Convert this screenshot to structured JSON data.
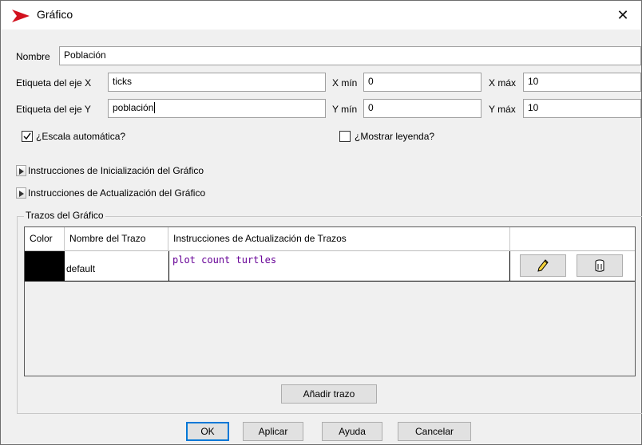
{
  "window": {
    "title": "Gráfico",
    "close_glyph": "✕",
    "accent_color": "#d2111e"
  },
  "form": {
    "name_label": "Nombre",
    "name_value": "Población",
    "x_axis_label": "Etiqueta del eje X",
    "x_axis_value": "ticks",
    "x_min_label": "X mín",
    "x_min_value": "0",
    "x_max_label": "X máx",
    "x_max_value": "10",
    "y_axis_label": "Etiqueta del eje Y",
    "y_axis_value": "población",
    "y_min_label": "Y mín",
    "y_min_value": "0",
    "y_max_label": "Y máx",
    "y_max_value": "10",
    "autoscale_label": "¿Escala automática?",
    "autoscale_checked": true,
    "legend_label": "¿Mostrar leyenda?",
    "legend_checked": false
  },
  "sections": {
    "setup_label": "Instrucciones de Inicialización del Gráfico",
    "update_label": "Instrucciones de Actualización del Gráfico"
  },
  "pens": {
    "group_label": "Trazos del Gráfico",
    "columns": [
      "Color",
      "Nombre del Trazo",
      "Instrucciones de Actualización de Trazos"
    ],
    "rows": [
      {
        "color": "#000000",
        "name": "default",
        "code": {
          "keyword1": "plot",
          "keyword2": "count",
          "argument": "turtles"
        },
        "edit_icon": "pencil-icon",
        "delete_icon": "trash-icon"
      }
    ],
    "add_button": "Añadir trazo"
  },
  "buttons": {
    "ok": "OK",
    "apply": "Aplicar",
    "help": "Ayuda",
    "cancel": "Cancelar"
  }
}
